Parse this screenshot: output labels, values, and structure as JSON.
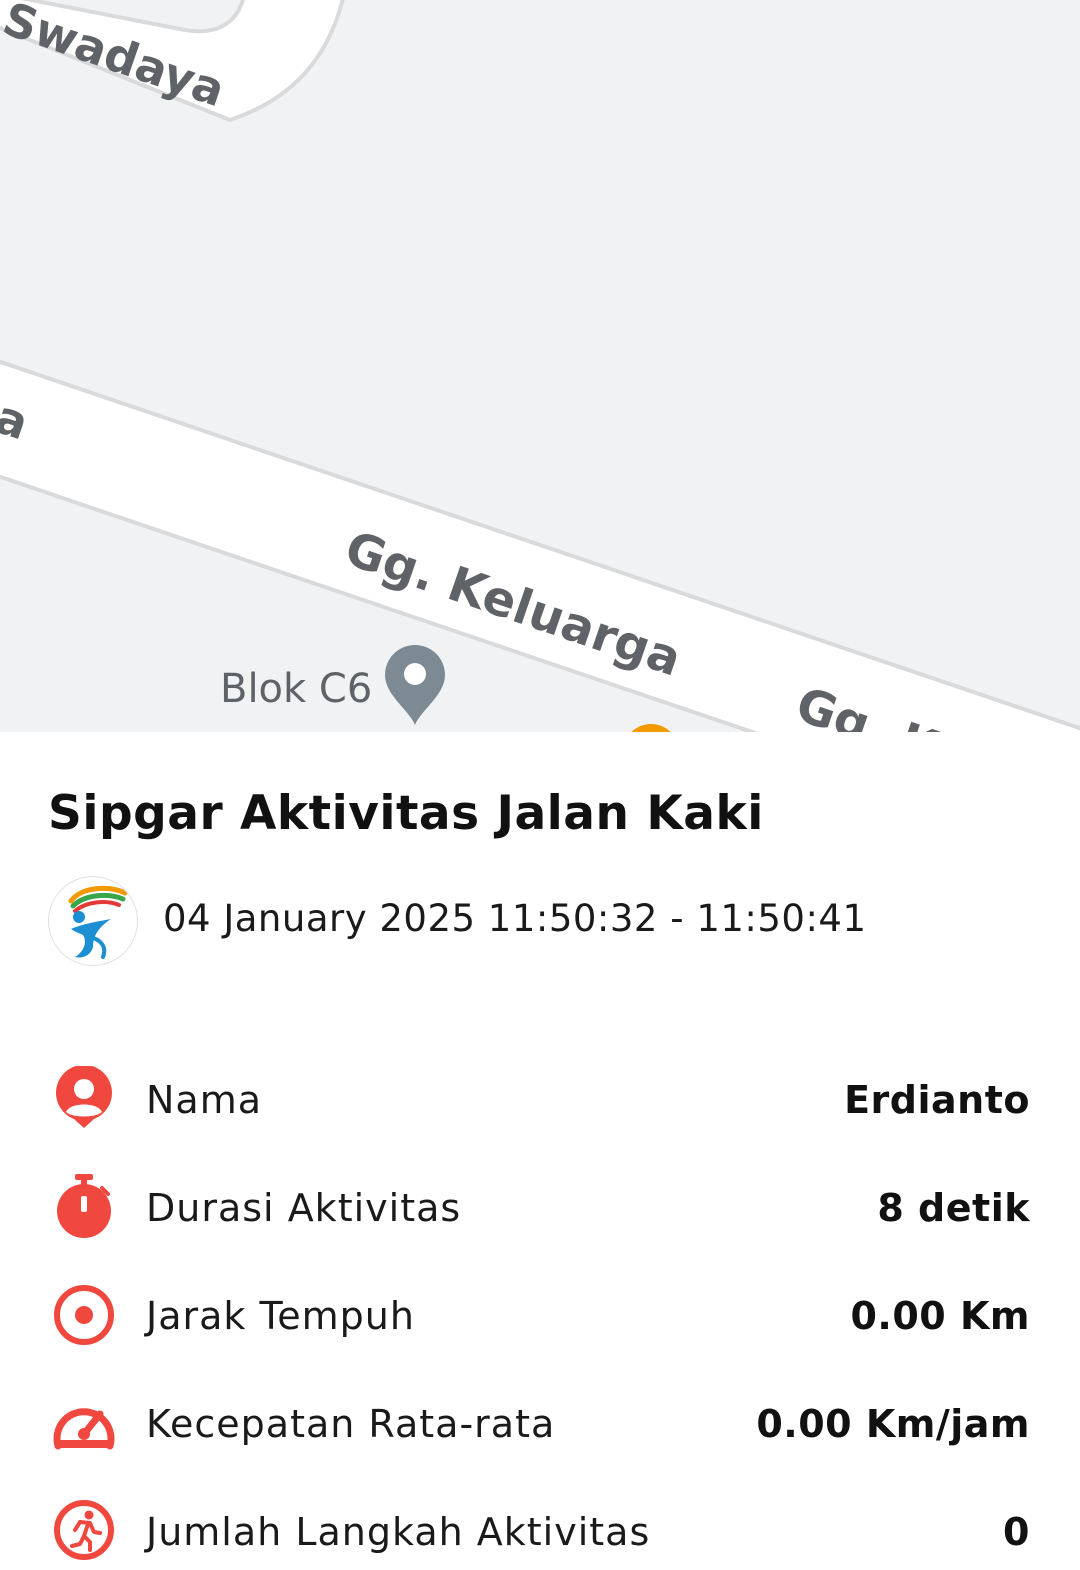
{
  "map": {
    "streets": [
      "Swadaya",
      "a",
      "Gg. Keluarga",
      "Gg. K"
    ],
    "places": [
      {
        "name": "Blok C6",
        "icon": "map-pin-icon"
      }
    ]
  },
  "activity": {
    "title": "Sipgar Aktivitas Jalan Kaki",
    "logo_icon": "sipgar-runner-logo",
    "datetime": "04 January 2025 11:50:32 - 11:50:41"
  },
  "details": [
    {
      "label": "Nama",
      "value": "Erdianto",
      "icon": "user-pin-icon"
    },
    {
      "label": "Durasi Aktivitas",
      "value": "8 detik",
      "icon": "stopwatch-icon"
    },
    {
      "label": "Jarak Tempuh",
      "value": "0.00 Km",
      "icon": "target-icon"
    },
    {
      "label": "Kecepatan Rata-rata",
      "value": "0.00 Km/jam",
      "icon": "speedometer-icon"
    },
    {
      "label": "Jumlah Langkah Aktivitas",
      "value": "0",
      "icon": "walking-person-icon"
    }
  ],
  "colors": {
    "accent": "#f0483e",
    "map_background": "#f1f2f4",
    "road": "#ffffff",
    "road_border": "#d9dadc",
    "map_label": "#5f6368",
    "pin": "#7d8a94",
    "poi_marker": "#f29900"
  }
}
